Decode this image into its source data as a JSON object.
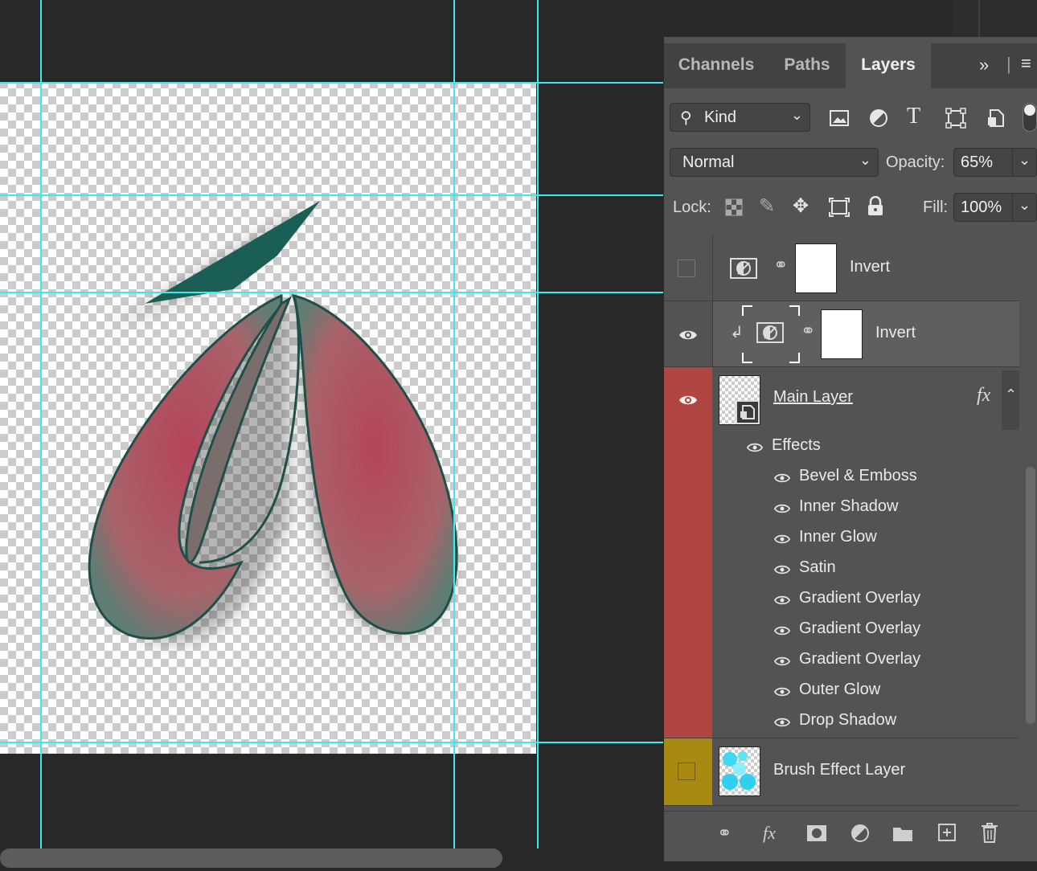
{
  "panel": {
    "tabs": [
      "Channels",
      "Paths",
      "Layers"
    ],
    "active_tab": "Layers",
    "overflow_icon": "double-chevron-right-icon",
    "menu_icon": "hamburger-menu-icon"
  },
  "filter": {
    "kind_label": "Kind",
    "filter_icons": [
      "image-icon",
      "adjustment-icon",
      "type-icon",
      "shape-icon",
      "smart-object-icon"
    ]
  },
  "blend": {
    "mode": "Normal",
    "opacity_label": "Opacity:",
    "opacity_value": "65%"
  },
  "lock": {
    "label": "Lock:",
    "fill_label": "Fill:",
    "fill_value": "100%"
  },
  "layers": [
    {
      "name": "Invert",
      "visible": false
    },
    {
      "name": "Invert",
      "visible": true,
      "clipped": true
    },
    {
      "name": "Main Layer",
      "visible": true,
      "color": "#b04542",
      "fx": "fx"
    },
    {
      "name": "Brush Effect Layer",
      "visible": false,
      "color": "#a88a12"
    }
  ],
  "effects": {
    "header": "Effects",
    "items": [
      "Bevel & Emboss",
      "Inner Shadow",
      "Inner Glow",
      "Satin",
      "Gradient Overlay",
      "Gradient Overlay",
      "Gradient Overlay",
      "Outer Glow",
      "Drop Shadow"
    ]
  },
  "colors": {
    "guide": "#3ee8ec",
    "main_layer_tag": "#b04542",
    "brush_layer_tag": "#a88a12",
    "glyph_fill": "#b56069"
  }
}
